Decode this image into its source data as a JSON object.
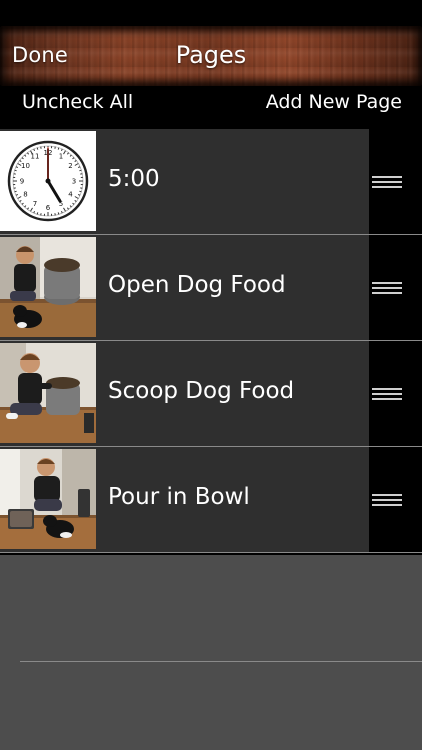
{
  "nav": {
    "done_label": "Done",
    "title": "Pages"
  },
  "toolbar": {
    "uncheck_all_label": "Uncheck All",
    "add_new_page_label": "Add New Page"
  },
  "pages": [
    {
      "label": "5:00",
      "thumbnail": "clock-icon"
    },
    {
      "label": "Open Dog Food",
      "thumbnail": "photo-open-dog-food"
    },
    {
      "label": "Scoop Dog Food",
      "thumbnail": "photo-scoop-dog-food"
    },
    {
      "label": "Pour in Bowl",
      "thumbnail": "photo-pour-in-bowl"
    }
  ],
  "clock": {
    "numbers": [
      "12",
      "1",
      "2",
      "3",
      "4",
      "5",
      "6",
      "7",
      "8",
      "9",
      "10",
      "11"
    ]
  },
  "colors": {
    "nav_wood": "#7a3a22",
    "row_background": "#2f2f2f",
    "empty_area": "#4d4d4d",
    "text": "#ffffff"
  }
}
